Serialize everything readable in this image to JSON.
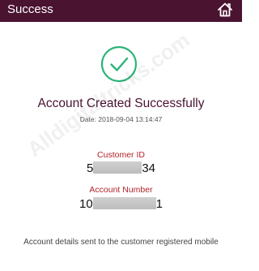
{
  "app_bar": {
    "title": "Success",
    "home_icon": "home-icon",
    "background": "#4a1330"
  },
  "status": {
    "icon": "check-circle-icon",
    "icon_color": "#2bb37a",
    "heading": "Account Created Successfully",
    "date": "Date: 2018-09-04 13:14:47"
  },
  "customer_id": {
    "label": "Customer ID",
    "value_prefix": "5",
    "value_suffix": "34"
  },
  "account_number": {
    "label": "Account Number",
    "value_prefix": "10",
    "value_suffix": "1"
  },
  "footer": {
    "message": "Account details sent to the customer registered mobile"
  },
  "watermark": "Alldigitaltricks.com",
  "colors": {
    "label_red": "#b3232a",
    "heading": "#4a1330"
  }
}
